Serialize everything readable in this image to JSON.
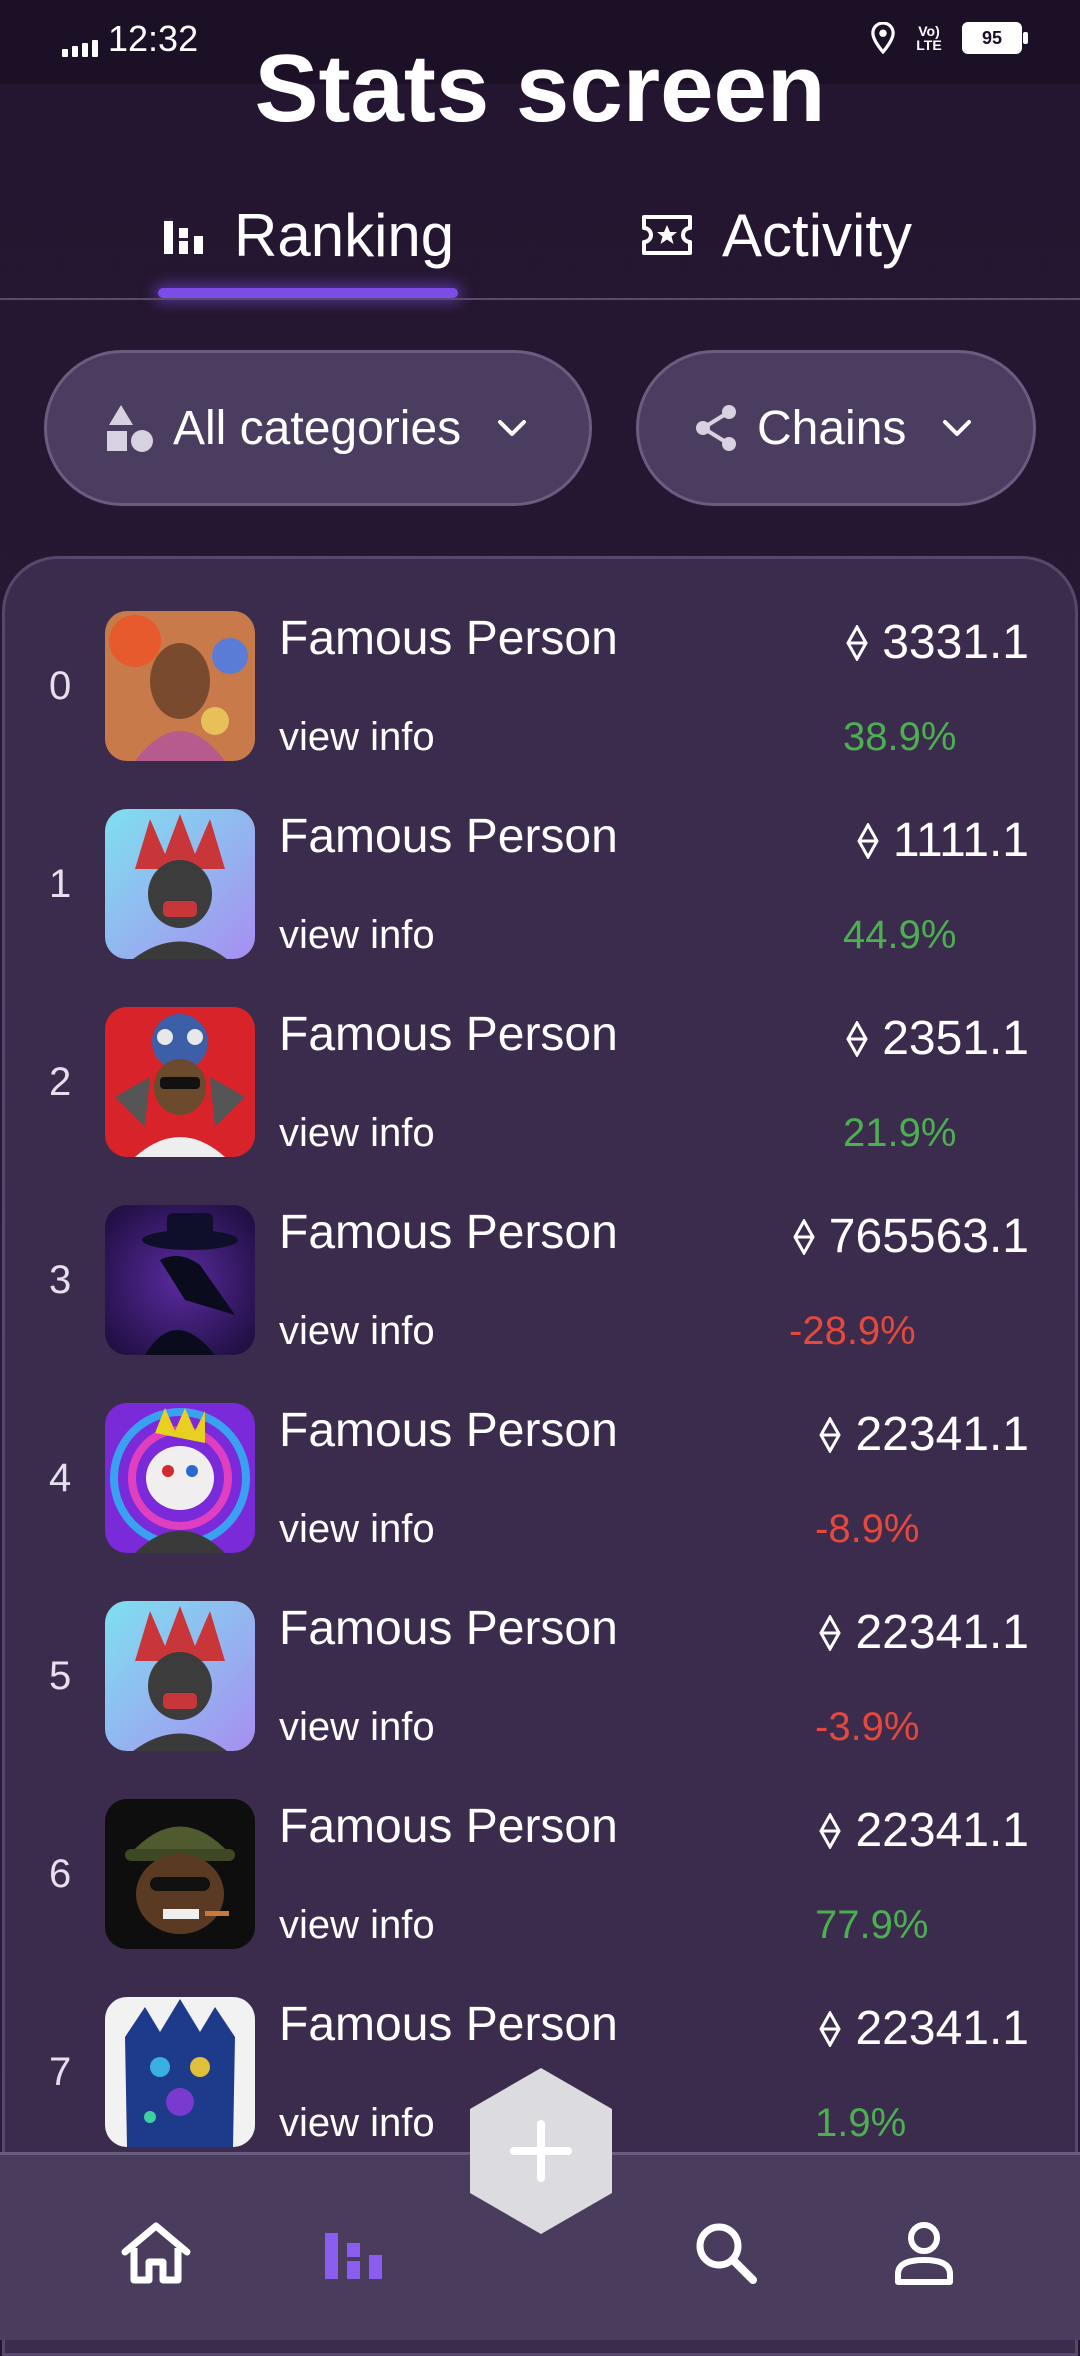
{
  "status_bar": {
    "time": "12:32",
    "battery": "95",
    "network": "Vo) LTE"
  },
  "page_title": "Stats screen",
  "tabs": [
    {
      "label": "Ranking",
      "icon": "bar-chart-icon",
      "selected": true
    },
    {
      "label": "Activity",
      "icon": "ticket-star-icon",
      "selected": false
    }
  ],
  "filters": {
    "categories_label": "All categories",
    "chains_label": "Chains"
  },
  "rankings": [
    {
      "rank": "0",
      "name": "Famous Person",
      "link": "view info",
      "price": "3331.1",
      "change": "38.9%",
      "trend": "up"
    },
    {
      "rank": "1",
      "name": "Famous Person",
      "link": "view info",
      "price": "1111.1",
      "change": "44.9%",
      "trend": "up"
    },
    {
      "rank": "2",
      "name": "Famous Person",
      "link": "view info",
      "price": "2351.1",
      "change": "21.9%",
      "trend": "up"
    },
    {
      "rank": "3",
      "name": "Famous Person",
      "link": "view info",
      "price": "765563.1",
      "change": "-28.9%",
      "trend": "down"
    },
    {
      "rank": "4",
      "name": "Famous Person",
      "link": "view info",
      "price": "22341.1",
      "change": "-8.9%",
      "trend": "down"
    },
    {
      "rank": "5",
      "name": "Famous Person",
      "link": "view info",
      "price": "22341.1",
      "change": "-3.9%",
      "trend": "down"
    },
    {
      "rank": "6",
      "name": "Famous Person",
      "link": "view info",
      "price": "22341.1",
      "change": "77.9%",
      "trend": "up"
    },
    {
      "rank": "7",
      "name": "Famous Person",
      "link": "view info",
      "price": "22341.1",
      "change": "1.9%",
      "trend": "up"
    }
  ],
  "bottom_nav": [
    {
      "icon": "home-icon",
      "active": false
    },
    {
      "icon": "stats-icon",
      "active": true
    },
    {
      "icon": "add-icon",
      "active": false
    },
    {
      "icon": "search-icon",
      "active": false
    },
    {
      "icon": "profile-icon",
      "active": false
    }
  ],
  "colors": {
    "accent": "#7b4de6",
    "positive": "#4caf50",
    "negative": "#e5483d",
    "background": "#24162f",
    "card": "#3b2c4e"
  }
}
